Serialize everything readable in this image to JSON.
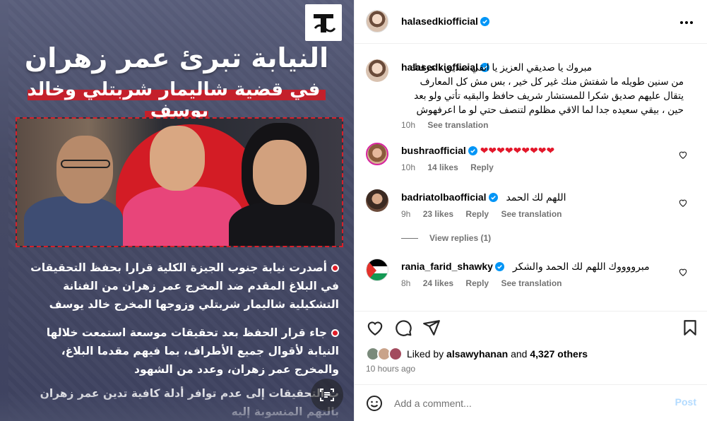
{
  "post_image": {
    "headline": "النيابة تبرئ عمر زهران",
    "subheadline": "في قضية شاليمار شربتلي وخالد يوسف",
    "bullets": [
      "أصدرت نيابة جنوب الجيزة الكلية قرارا بحفظ التحقيقات في البلاغ المقدم ضد المخرج عمر زهران من الفنانة التشكيلية شاليمار شربتلي وزوجها المخرج خالد يوسف",
      "جاء قرار الحفظ بعد تحقيقات موسعة استمعت خلالها النيابة لأقوال جميع الأطراف، بما فيهم مقدما البلاغ، والمخرج عمر زهران، وعدد من الشهود",
      "ت التحقيقات إلى عدم توافر أدلة كافية تدين عمر زهران بالتهم المنسوبة إليه"
    ]
  },
  "header": {
    "username": "halasedkiofficial"
  },
  "caption": {
    "username": "halasedkiofficial",
    "text": "مبروك يا صديقي العزيز يا انقي صديق ، عرفتك من سنين طويله ما شفتش منك غير كل خير ، بس مش كل المعارف يتقال عليهم صديق شكرا للمستشار شريف حافظ والبقيه تأتي ولو بعد حين ، بيقي سعيده جدا لما الاقي مظلوم لتنصف حتي لو ما اعرفهوش",
    "time": "10h",
    "see_translation": "See translation"
  },
  "comments": [
    {
      "username": "bushraofficial",
      "text": "❤❤❤❤❤❤❤❤❤",
      "time": "10h",
      "likes": "14 likes",
      "reply": "Reply"
    },
    {
      "username": "badriatolbaofficial",
      "text": "اللهم لك الحمد",
      "time": "9h",
      "likes": "23 likes",
      "reply": "Reply",
      "see_translation": "See translation"
    },
    {
      "username": "rania_farid_shawky",
      "text": "مبرووووك اللهم لك الحمد والشكر",
      "time": "8h",
      "likes": "24 likes",
      "reply": "Reply",
      "see_translation": "See translation"
    }
  ],
  "view_replies": "View replies (1)",
  "likes_line": {
    "prefix": "Liked by",
    "user": "alsawyhanan",
    "joiner": "and",
    "others": "4,327 others"
  },
  "posted_ago": "10 hours ago",
  "add_comment": {
    "placeholder": "Add a comment...",
    "post_label": "Post"
  },
  "colors": {
    "verified": "#0095f6",
    "post_disabled": "#b3dbff",
    "heart_red": "#e3172a",
    "image_bg": "#4a4f6b",
    "headline_red": "#c4202b"
  }
}
